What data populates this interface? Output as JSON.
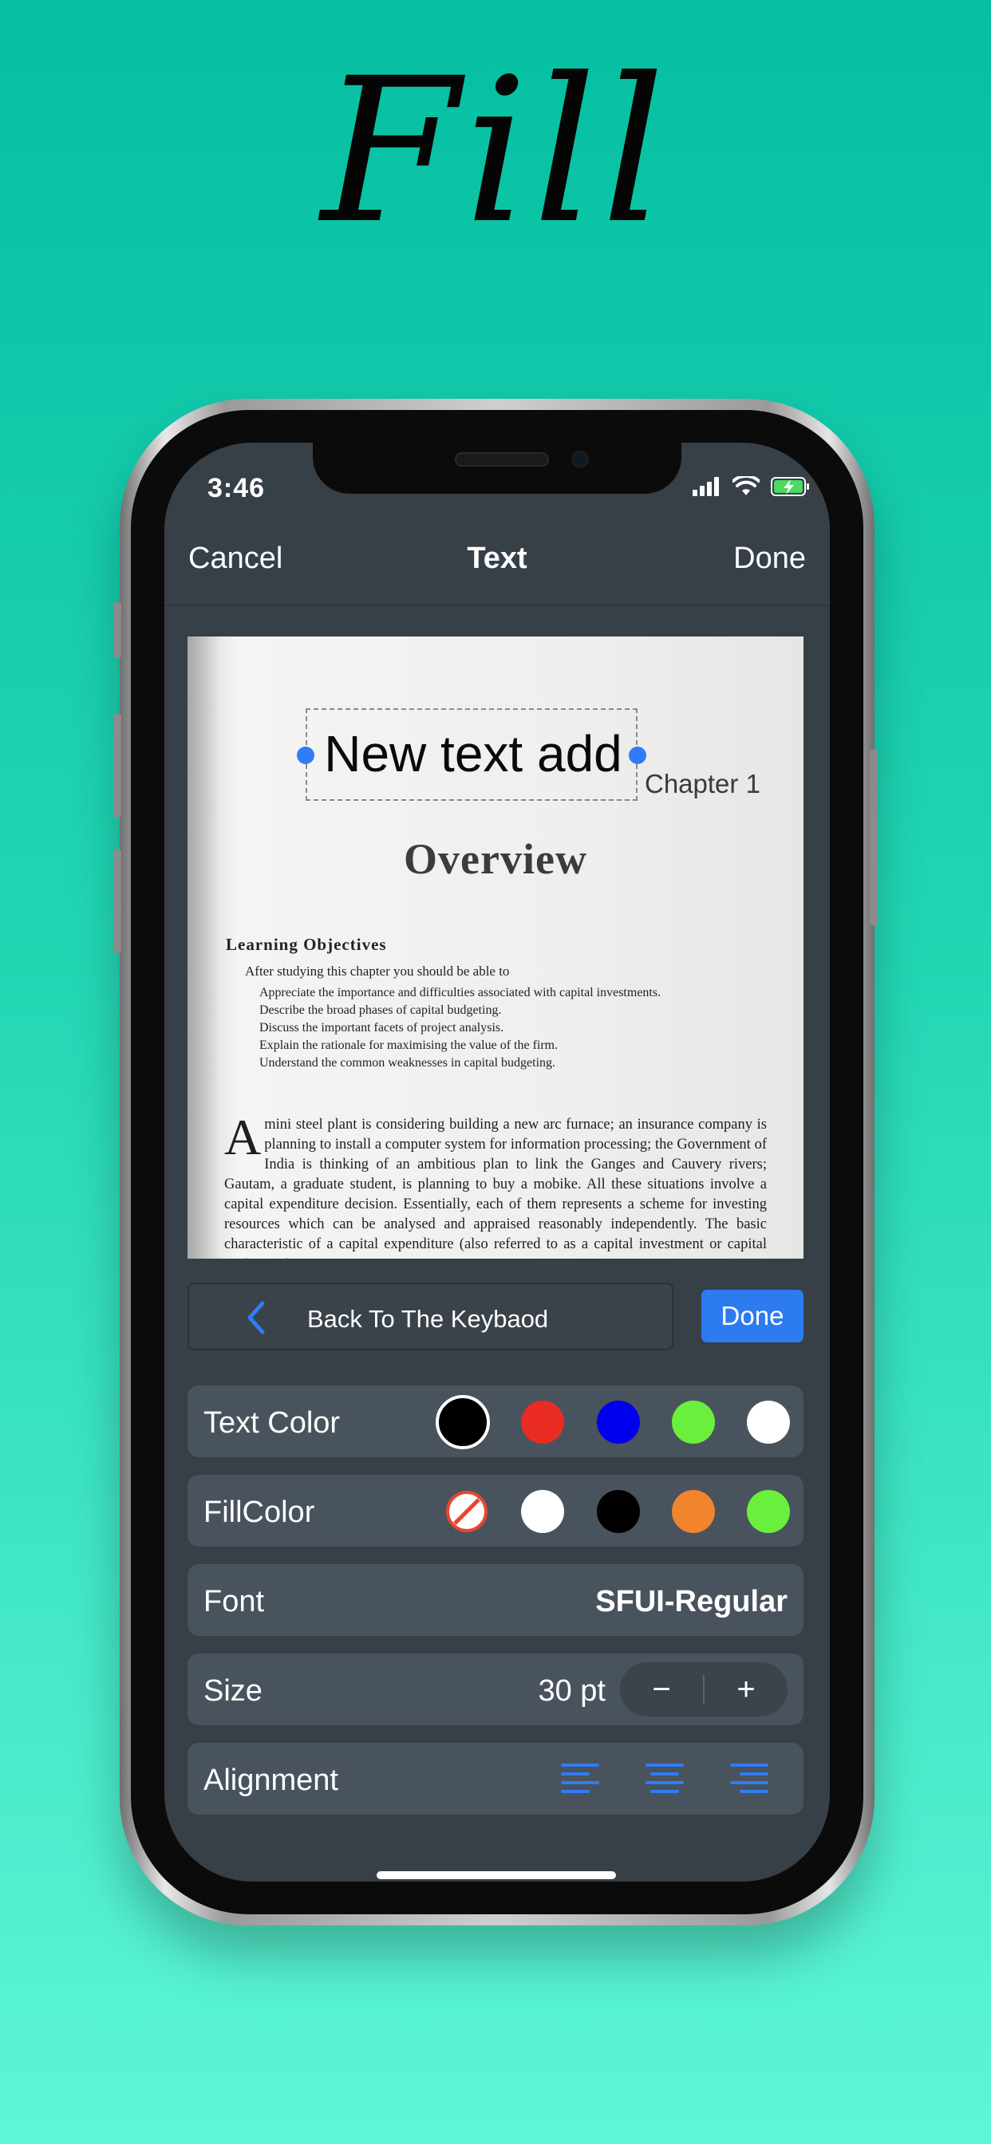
{
  "headline": "Fill",
  "status_bar": {
    "time": "3:46"
  },
  "nav": {
    "cancel": "Cancel",
    "title": "Text",
    "done": "Done"
  },
  "document": {
    "added_text": "New text add",
    "chapter": "Chapter 1",
    "heading": "Overview",
    "objectives_title": "Learning Objectives",
    "objectives_intro": "After studying this chapter you should be able to",
    "objectives": [
      "Appreciate the importance and difficulties associated with capital investments.",
      "Describe the broad phases of capital budgeting.",
      "Discuss the important facets of project analysis.",
      "Explain the rationale for maximising the value of the firm.",
      "Understand the common weaknesses in capital budgeting."
    ],
    "para_dropcap": "A",
    "paragraph": "mini steel plant is considering building a new arc furnace; an insurance company is planning to install a computer system for information processing; the Government of India is thinking of an ambitious plan to link the Ganges and Cauvery rivers; Gautam, a graduate student, is planning to buy a mobike. All these situations involve a capital expenditure decision. Essentially, each of them represents a scheme for investing resources which can be analysed and appraised reasonably independently. The basic characteristic of a capital expenditure (also referred to as a capital investment or capital project or just"
  },
  "toolbar": {
    "back_label": "Back To The Keybaod",
    "done_label": "Done"
  },
  "settings": {
    "text_color": {
      "label": "Text Color",
      "colors": [
        "#000000",
        "#ea2b23",
        "#0000ee",
        "#6af03c",
        "#ffffff"
      ],
      "selected": 0
    },
    "fill_color": {
      "label": "FillColor",
      "colors": [
        "none",
        "#ffffff",
        "#000000",
        "#f0852e",
        "#6af03c"
      ]
    },
    "font": {
      "label": "Font",
      "value": "SFUI-Regular"
    },
    "size": {
      "label": "Size",
      "value": "30 pt",
      "minus": "−",
      "plus": "+"
    },
    "alignment": {
      "label": "Alignment",
      "options": [
        "left",
        "center",
        "right"
      ]
    }
  },
  "colors": {
    "accent": "#2f7cf6",
    "screen_bg": "#373f47",
    "row_bg": "#49535d"
  }
}
